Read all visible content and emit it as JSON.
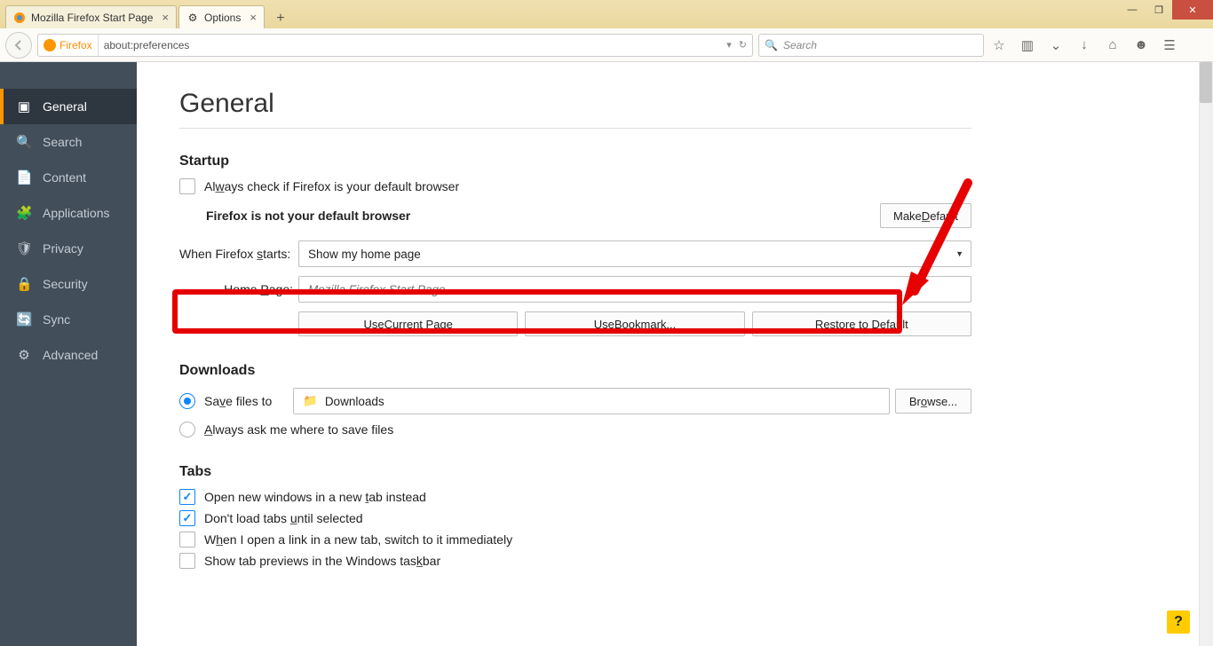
{
  "window": {
    "tabs": [
      {
        "label": "Mozilla Firefox Start Page",
        "active": false
      },
      {
        "label": "Options",
        "active": true
      }
    ],
    "controls": {
      "min": "—",
      "max": "❐",
      "close": "✕"
    }
  },
  "navbar": {
    "identity": "Firefox",
    "url": "about:preferences",
    "dropdown_hint": "▾",
    "reload": "↻",
    "search_placeholder": "Search"
  },
  "toolbar_icons": [
    "star",
    "sidebar",
    "pocket",
    "downloads",
    "home",
    "chat",
    "menu"
  ],
  "sidebar": {
    "items": [
      {
        "label": "General",
        "icon": "▣"
      },
      {
        "label": "Search",
        "icon": "🔍"
      },
      {
        "label": "Content",
        "icon": "📄"
      },
      {
        "label": "Applications",
        "icon": "🧩"
      },
      {
        "label": "Privacy",
        "icon": "🛡"
      },
      {
        "label": "Security",
        "icon": "🔒"
      },
      {
        "label": "Sync",
        "icon": "🔄"
      },
      {
        "label": "Advanced",
        "icon": "⚙"
      }
    ],
    "selected_index": 0
  },
  "page": {
    "title": "General",
    "startup": {
      "heading": "Startup",
      "always_check_label": "Always check if Firefox is your default browser",
      "always_check_checked": false,
      "not_default_text": "Firefox is not your default browser",
      "make_default_label": "Make Default",
      "when_starts_label": "When Firefox starts:",
      "when_starts_value": "Show my home page",
      "home_page_label": "Home Page:",
      "home_page_placeholder": "Mozilla Firefox Start Page",
      "use_current_label": "Use Current Page",
      "use_bookmark_label": "Use Bookmark...",
      "restore_default_label": "Restore to Default"
    },
    "downloads": {
      "heading": "Downloads",
      "save_to_label": "Save files to",
      "save_to_path": "Downloads",
      "browse_label": "Browse...",
      "always_ask_label": "Always ask me where to save files",
      "choice": "save"
    },
    "tabs": {
      "heading": "Tabs",
      "opt1": "Open new windows in a new tab instead",
      "opt2": "Don't load tabs until selected",
      "opt3": "When I open a link in a new tab, switch to it immediately",
      "opt4": "Show tab previews in the Windows taskbar",
      "checked": {
        "opt1": true,
        "opt2": true,
        "opt3": false,
        "opt4": false
      }
    }
  },
  "help": "?"
}
